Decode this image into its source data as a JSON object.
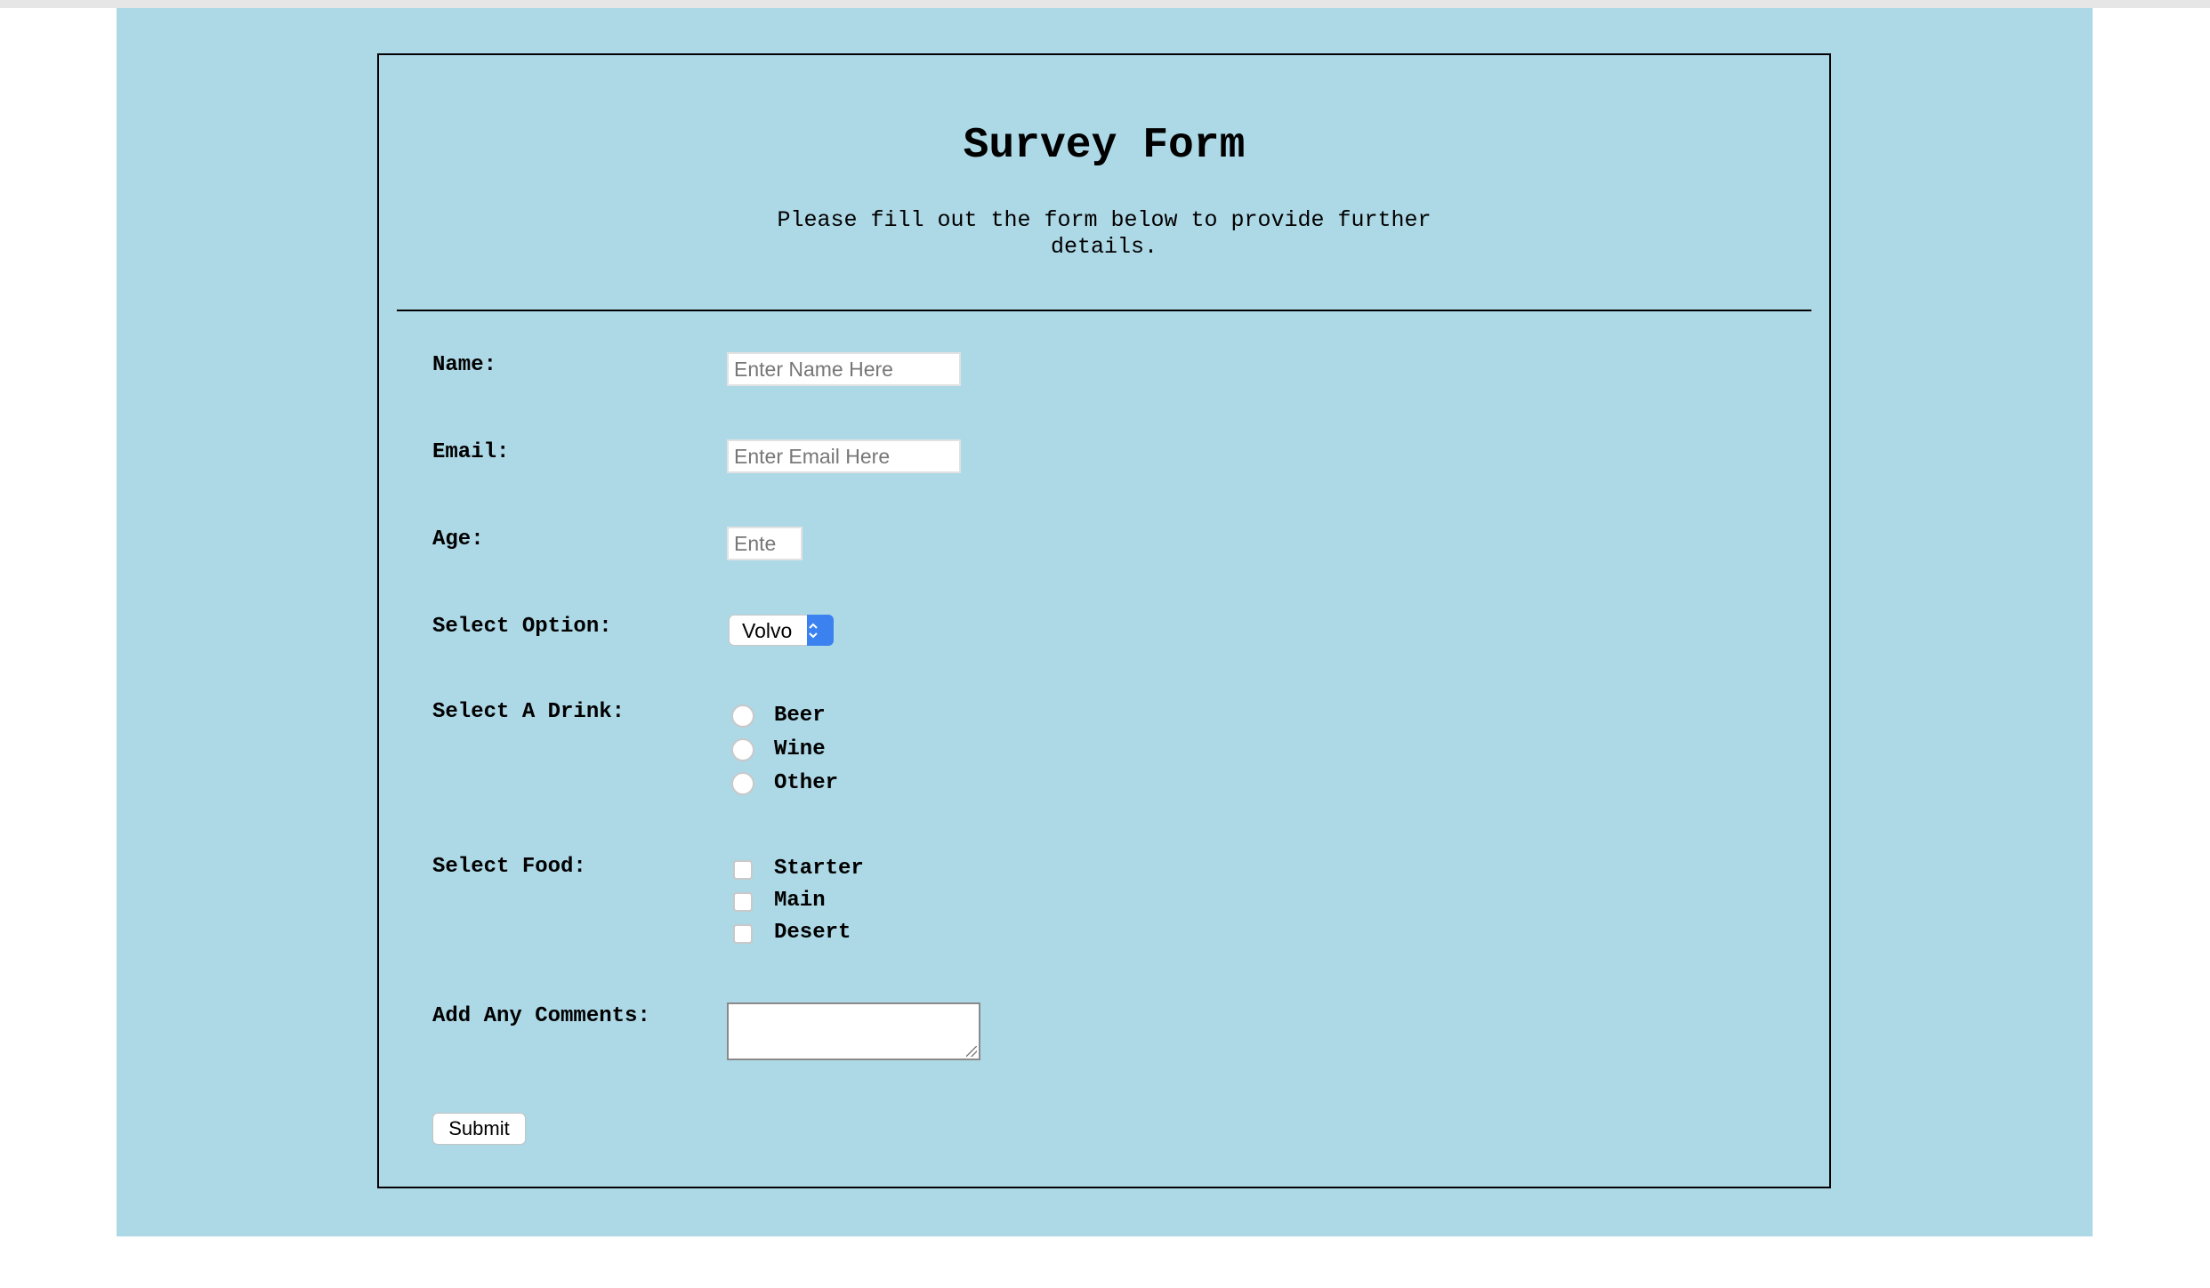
{
  "form": {
    "title": "Survey Form",
    "description_line1": "Please fill out the form below to provide further",
    "description_line2": "details."
  },
  "fields": {
    "name": {
      "label": "Name:",
      "placeholder": "Enter Name Here",
      "value": ""
    },
    "email": {
      "label": "Email:",
      "placeholder": "Enter Email Here",
      "value": ""
    },
    "age": {
      "label": "Age:",
      "placeholder": "Ente",
      "value": ""
    },
    "option": {
      "label": "Select Option:",
      "selected": "Volvo"
    },
    "drink": {
      "label": "Select A Drink:",
      "options": [
        "Beer",
        "Wine",
        "Other"
      ],
      "selected": null
    },
    "food": {
      "label": "Select Food:",
      "options": [
        "Starter",
        "Main",
        "Desert"
      ],
      "checked": [
        false,
        false,
        false
      ]
    },
    "comments": {
      "label": "Add Any Comments:",
      "value": ""
    }
  },
  "submit_label": "Submit",
  "colors": {
    "page_background": "#add8e6",
    "border": "#000000",
    "select_accent": "#3b82f0"
  },
  "icons": {
    "select_arrows": "chevron-up-down-icon",
    "textarea_resize": "resize-grip-icon"
  }
}
